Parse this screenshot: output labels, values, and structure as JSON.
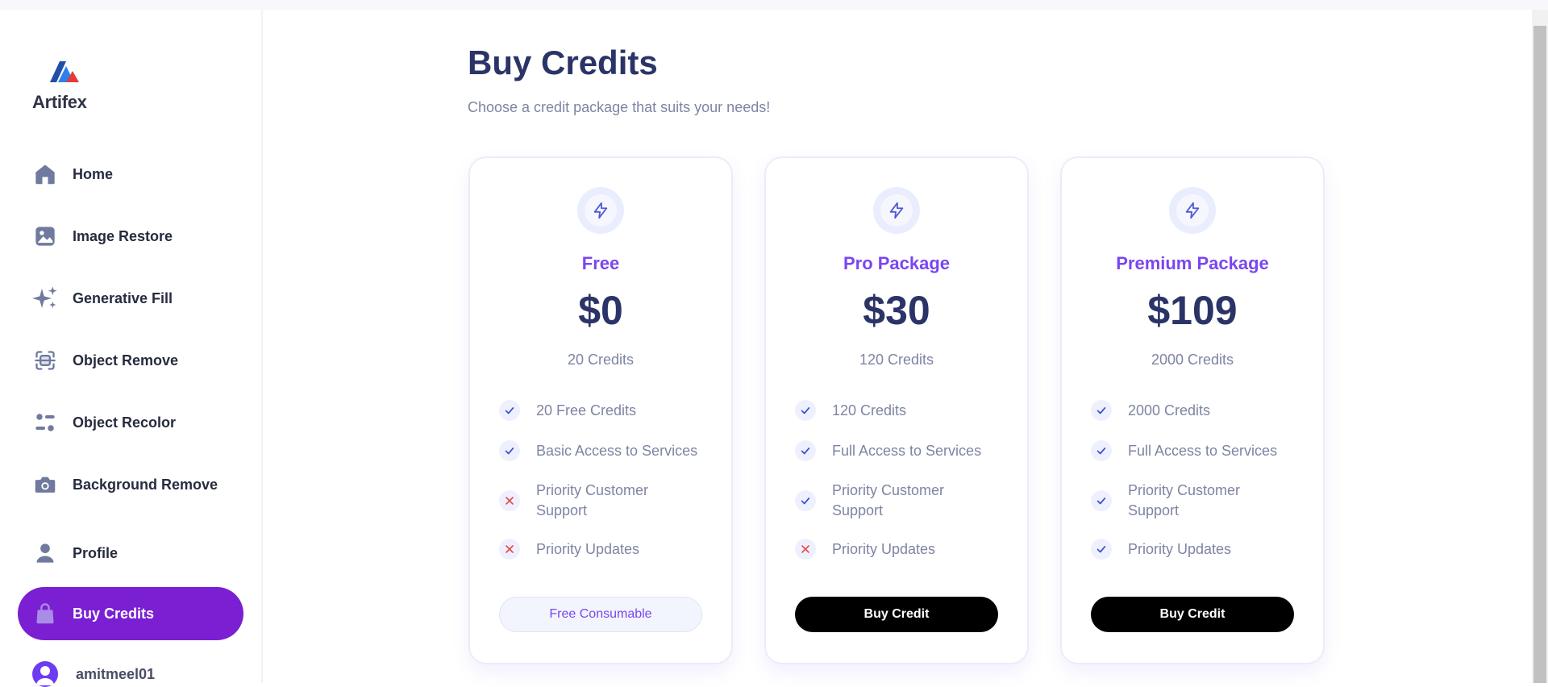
{
  "brand": {
    "name": "Artifex"
  },
  "sidebar": {
    "items": [
      {
        "label": "Home",
        "icon": "home-icon"
      },
      {
        "label": "Image Restore",
        "icon": "image-icon"
      },
      {
        "label": "Generative Fill",
        "icon": "sparkles-icon"
      },
      {
        "label": "Object Remove",
        "icon": "scan-icon"
      },
      {
        "label": "Object Recolor",
        "icon": "filter-icon"
      },
      {
        "label": "Background Remove",
        "icon": "camera-icon"
      },
      {
        "label": "Profile",
        "icon": "user-icon"
      },
      {
        "label": "Buy Credits",
        "icon": "bag-icon",
        "active": true
      }
    ],
    "user": {
      "name": "amitmeel01"
    }
  },
  "main": {
    "title": "Buy Credits",
    "subtitle": "Choose a credit package that suits your needs!"
  },
  "plans": [
    {
      "name": "Free",
      "price": "$0",
      "credits": "20 Credits",
      "features": [
        {
          "text": "20 Free Credits",
          "included": true
        },
        {
          "text": "Basic Access to Services",
          "included": true
        },
        {
          "text": "Priority Customer Support",
          "included": false
        },
        {
          "text": "Priority Updates",
          "included": false
        }
      ],
      "button": "Free Consumable"
    },
    {
      "name": "Pro Package",
      "price": "$30",
      "credits": "120 Credits",
      "features": [
        {
          "text": "120 Credits",
          "included": true
        },
        {
          "text": "Full Access to Services",
          "included": true
        },
        {
          "text": "Priority Customer Support",
          "included": true
        },
        {
          "text": "Priority Updates",
          "included": false
        }
      ],
      "button": "Buy Credit"
    },
    {
      "name": "Premium Package",
      "price": "$109",
      "credits": "2000 Credits",
      "features": [
        {
          "text": "2000 Credits",
          "included": true
        },
        {
          "text": "Full Access to Services",
          "included": true
        },
        {
          "text": "Priority Customer Support",
          "included": true
        },
        {
          "text": "Priority Updates",
          "included": true
        }
      ],
      "button": "Buy Credit"
    }
  ],
  "colors": {
    "accent": "#7b1fd3",
    "title": "#2b3467",
    "plan_name": "#7a46f0",
    "check": "#3b4fd8",
    "cross": "#e5484d"
  }
}
